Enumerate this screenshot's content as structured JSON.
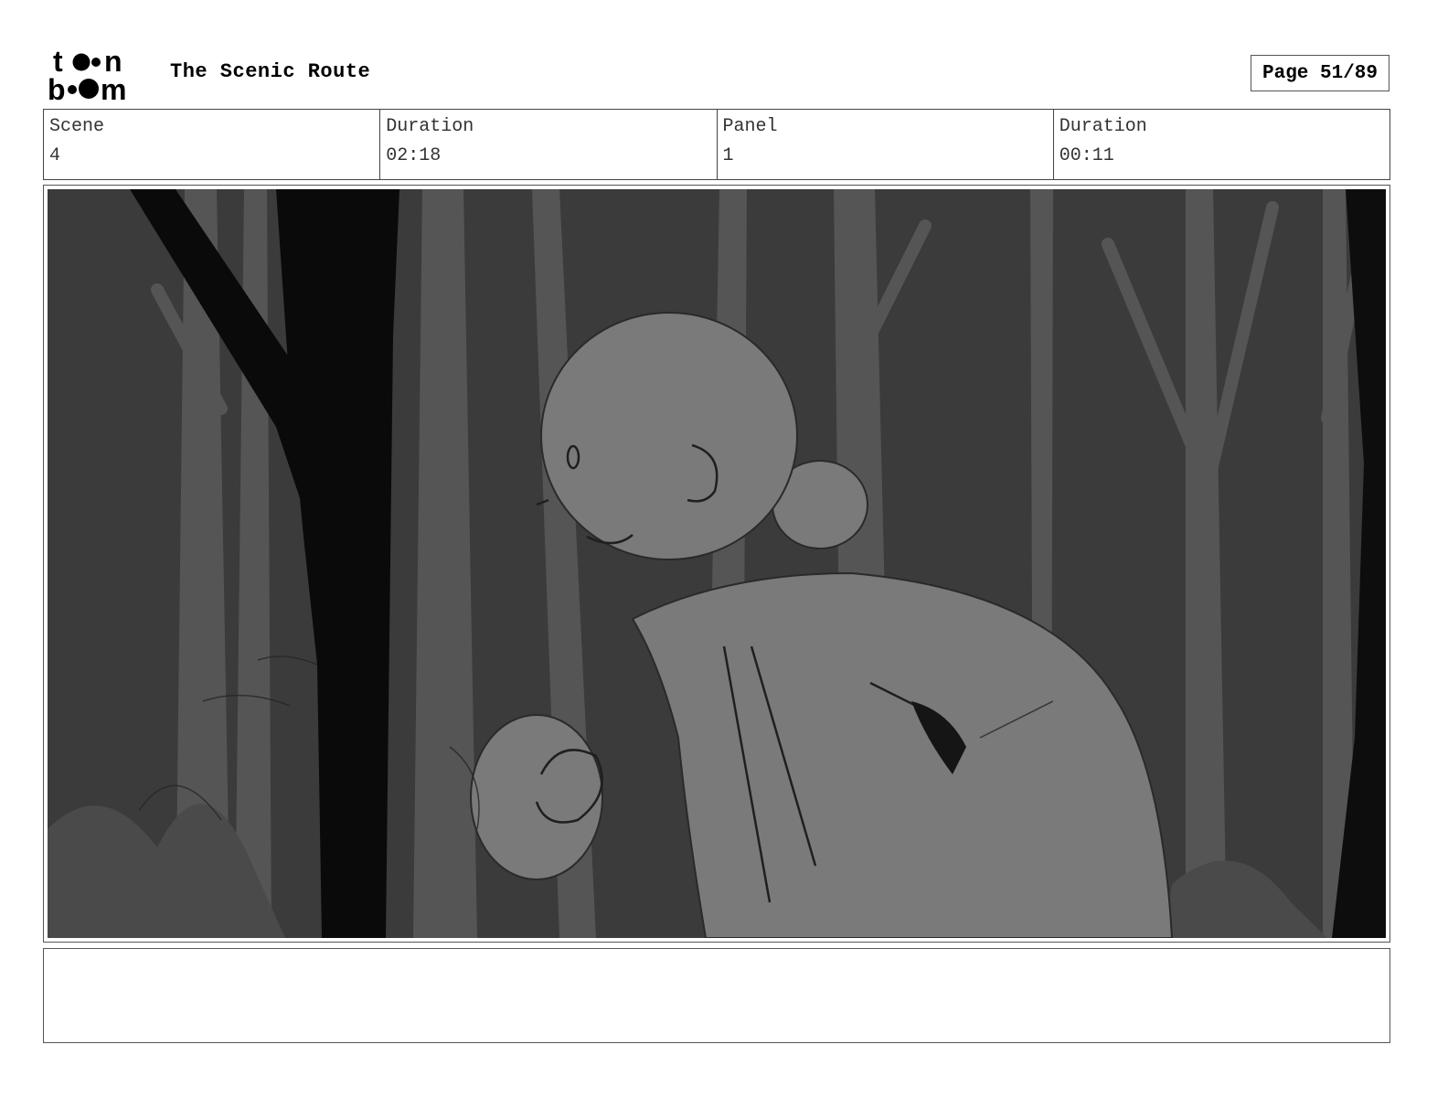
{
  "header": {
    "logo_text": "toon boom",
    "title": "The Scenic Route",
    "page_label": "Page 51/89"
  },
  "info": {
    "scene_label": "Scene",
    "scene_value": "4",
    "scene_duration_label": "Duration",
    "scene_duration_value": "02:18",
    "panel_label": "Panel",
    "panel_value": "1",
    "panel_duration_label": "Duration",
    "panel_duration_value": "00:11"
  },
  "notes": {
    "text": ""
  }
}
